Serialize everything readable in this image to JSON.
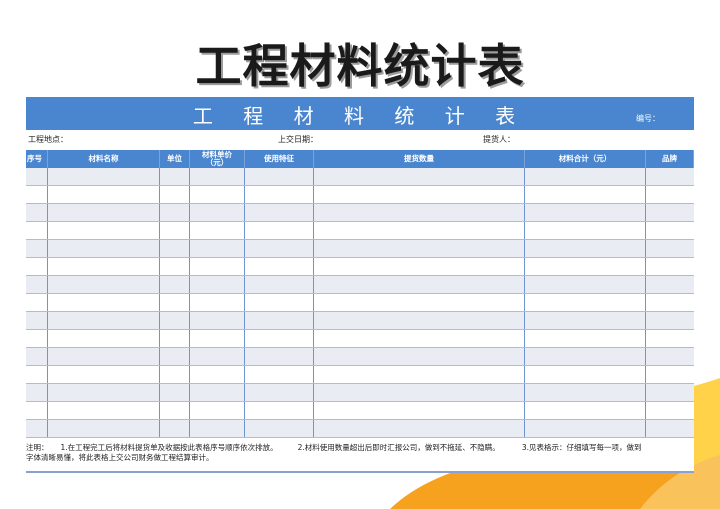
{
  "page": {
    "title": "工程材料统计表"
  },
  "sheet": {
    "banner_title": "工 程 材 料 统 计 表",
    "serial_label": "编号：",
    "info": {
      "site_label": "工程地点：",
      "date_label": "上交日期：",
      "supplier_label": "提货人："
    },
    "columns": [
      "序号",
      "材料名称",
      "单位",
      "材料单价\n（元）",
      "使用特征",
      "提货数量",
      "材料合计（元）",
      "品牌"
    ],
    "row_count": 15,
    "notes": {
      "prefix": "注明：",
      "item1": "1.在工程完工后将材料提货单及收据按此表格序号顺序依次排放。",
      "item2": "2.材料使用数量超出后即时汇报公司，做到不拖延、不隐瞒。",
      "item3": "3.见表格示：仔细填写每一项，做到",
      "continuation": "字体清晰易懂，将此表格上交公司财务做工程结算审计。"
    }
  },
  "colors": {
    "banner": "#4a86cf",
    "row_alt": "#e9edf3",
    "deco_orange": "#f6a21e",
    "deco_yellow": "#ffd24a",
    "deco_blue": "#5aa9e6"
  }
}
